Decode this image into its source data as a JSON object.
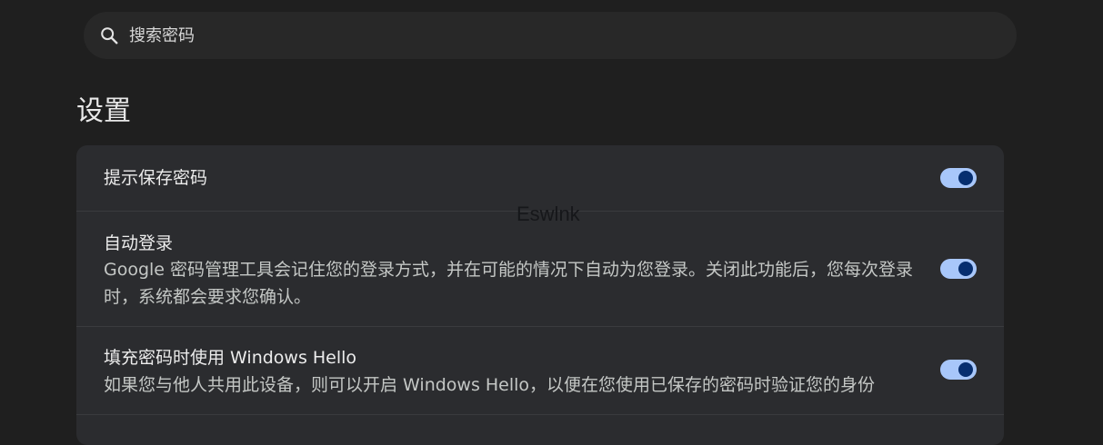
{
  "search": {
    "placeholder": "搜索密码",
    "icon": "search-icon"
  },
  "settings": {
    "title": "设置",
    "items": [
      {
        "label": "提示保存密码",
        "description": "",
        "enabled": true
      },
      {
        "label": "自动登录",
        "description": "Google 密码管理工具会记住您的登录方式，并在可能的情况下自动为您登录。关闭此功能后，您每次登录时，系统都会要求您确认。",
        "enabled": true
      },
      {
        "label": "填充密码时使用 Windows Hello",
        "description": "如果您与他人共用此设备，则可以开启 Windows Hello，以便在您使用已保存的密码时验证您的身份",
        "enabled": true
      }
    ]
  },
  "watermark": "Eswlnk",
  "colors": {
    "background": "#1f1f1f",
    "card": "#2b2c2f",
    "toggle_track": "#a8c7fa",
    "toggle_knob": "#062e6f"
  }
}
